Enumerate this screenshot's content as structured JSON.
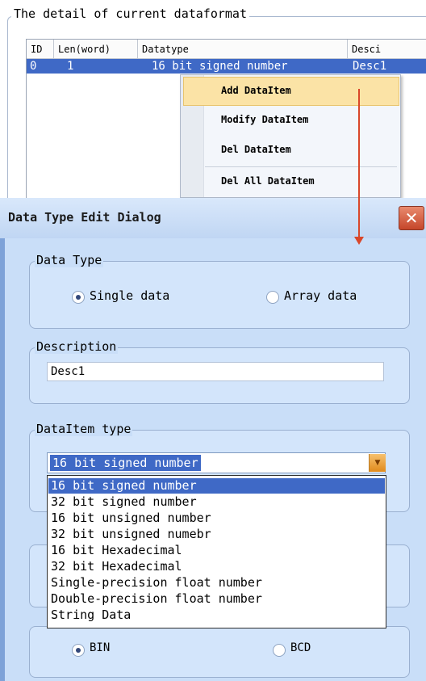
{
  "top_group": {
    "title": "The detail of current dataformat"
  },
  "table": {
    "headers": [
      "ID",
      "Len(word)",
      "Datatype",
      "Desci"
    ],
    "rows": [
      [
        "0",
        "1",
        "16 bit signed number",
        "Desc1"
      ]
    ]
  },
  "context_menu": {
    "items": [
      "Add DataItem",
      "Modify DataItem",
      "Del DataItem",
      "Del All DataItem"
    ]
  },
  "dialog": {
    "title": "Data Type Edit Dialog",
    "close_glyph": "✕",
    "data_type": {
      "title": "Data Type",
      "options": [
        "Single data",
        "Array data"
      ],
      "selected": "Single data"
    },
    "description": {
      "title": "Description",
      "value": "Desc1"
    },
    "dataitem_type": {
      "title": "DataItem type",
      "selected": "16 bit signed number",
      "options": [
        "16 bit signed number",
        "32 bit signed number",
        "16 bit unsigned number",
        "32 bit unsigned numebr",
        "16 bit Hexadecimal",
        "32 bit Hexadecimal",
        "Single-precision float number",
        "Double-precision float number",
        "String Data"
      ]
    },
    "code_type": {
      "options": [
        "BIN",
        "BCD"
      ],
      "selected": "BIN"
    }
  },
  "colors": {
    "accent_selection": "#3f69c6",
    "arrow": "#d9472a",
    "dialog_bg": "#c9def8"
  }
}
